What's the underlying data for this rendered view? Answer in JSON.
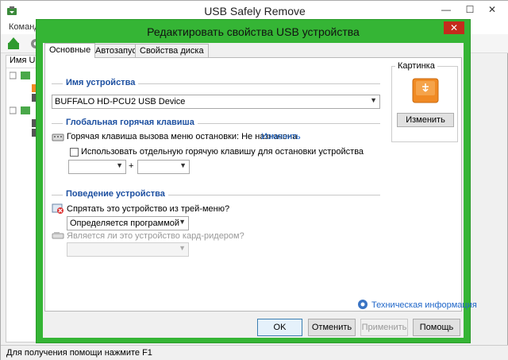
{
  "main_window": {
    "title": "USB Safely Remove",
    "min_glyph": "—",
    "max_glyph": "☐",
    "close_glyph": "✕",
    "menu": [
      "Команды"
    ],
    "column_header": "Имя USB",
    "status_text": "Для получения помощи нажмите F1"
  },
  "dialog": {
    "title": "Редактировать свойства USB устройства",
    "close_glyph": "✕",
    "tabs": [
      {
        "label": "Основные",
        "active": true
      },
      {
        "label": "Автозапуск",
        "active": false
      },
      {
        "label": "Свойства диска",
        "active": false
      }
    ],
    "device_name": {
      "section_title": "Имя устройства",
      "value": "BUFFALO HD-PCU2 USB Device"
    },
    "hotkey": {
      "section_title": "Глобальная горячая клавиша",
      "menu_hotkey_label": "Горячая клавиша вызова меню остановки: Не назначена",
      "change_link": "Изменить",
      "separate_hotkey_label": "Использовать отдельную горячую клавишу для остановки устройства",
      "separate_hotkey_checked": false,
      "key1_value": "",
      "plus": "+",
      "key2_value": ""
    },
    "behavior": {
      "section_title": "Поведение устройства",
      "hide_label": "Спрятать это устройство из трей-меню?",
      "hide_value": "Определяется программой",
      "cardreader_label": "Является ли это устройство кард-ридером?",
      "cardreader_value": ""
    },
    "picture": {
      "group_title": "Картинка",
      "change_button": "Изменить"
    },
    "tech_info_link": "Техническая информация",
    "buttons": {
      "ok": "OK",
      "cancel": "Отменить",
      "apply": "Применить",
      "help": "Помощь"
    }
  },
  "colors": {
    "dialog_frame": "#35b535",
    "section_title": "#1c4fa0",
    "link": "#2067c9",
    "close_button": "#c42b1c",
    "drive_orange": "#f08a24"
  }
}
